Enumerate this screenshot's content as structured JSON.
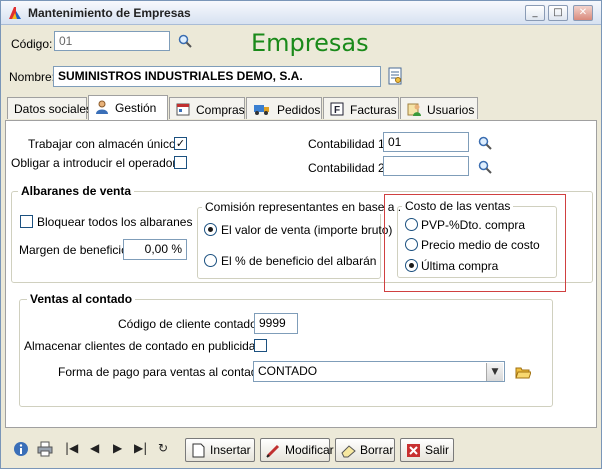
{
  "window": {
    "title": "Mantenimiento de Empresas",
    "controls": {
      "minimize": "_",
      "maximize": "□",
      "close": "✕"
    }
  },
  "header": {
    "codigo_label": "Código:",
    "codigo_value": "01",
    "big_title": "Empresas",
    "nombre_label": "Nombre:",
    "nombre_value": "SUMINISTROS INDUSTRIALES DEMO, S.A."
  },
  "tabs": [
    {
      "label": "Datos sociales",
      "icon": "none"
    },
    {
      "label": "Gestión",
      "icon": "person-icon",
      "active": true
    },
    {
      "label": "Compras",
      "icon": "calendar-icon"
    },
    {
      "label": "Pedidos",
      "icon": "truck-icon"
    },
    {
      "label": "Facturas",
      "icon": "invoice-icon"
    },
    {
      "label": "Usuarios",
      "icon": "users-icon"
    }
  ],
  "gestion": {
    "almacen_label": "Trabajar con almacén único:",
    "almacen_checked": "✓",
    "operador_label": "Obligar a introducir el operador:",
    "contabilidad1_label": "Contabilidad 1:",
    "contabilidad1_value": "01",
    "contabilidad2_label": "Contabilidad 2:",
    "contabilidad2_value": ""
  },
  "albaranes": {
    "title": "Albaranes de venta",
    "bloquear_label": "Bloquear todos los albaranes",
    "margen_label": "Margen de beneficio:",
    "margen_value": "0,00 %",
    "comision_title": "Comisión representantes en base a ...",
    "comision_options": [
      "El valor de venta (importe bruto)",
      "El % de beneficio del albarán"
    ],
    "comision_selected": 0,
    "costo_title": "Costo de las ventas",
    "costo_options": [
      "PVP-%Dto. compra",
      "Precio medio de costo",
      "Última compra"
    ],
    "costo_selected": 2
  },
  "contado": {
    "title": "Ventas al contado",
    "cliente_label": "Código de cliente contado:",
    "cliente_value": "9999",
    "almacenar_label": "Almacenar clientes de contado en publicidad:",
    "forma_label": "Forma de pago para ventas al contado:",
    "forma_value": "CONTADO"
  },
  "toolbar": {
    "nav": [
      "|◀",
      "◀",
      "▶",
      "▶|",
      "↻"
    ],
    "insertar": "Insertar",
    "modificar": "Modificar",
    "borrar": "Borrar",
    "salir": "Salir"
  },
  "colors": {
    "big_title": "#1a8a1a",
    "highlight": "#d04040",
    "window_bg": "#ece9d8"
  }
}
